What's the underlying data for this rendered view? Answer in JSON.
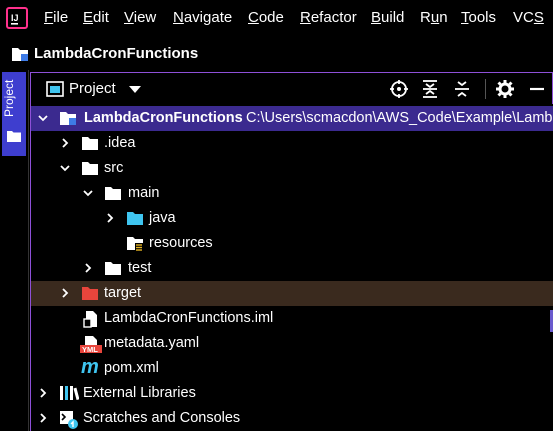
{
  "menu": {
    "items": [
      {
        "pre": "",
        "u": "F",
        "post": "ile"
      },
      {
        "pre": "",
        "u": "E",
        "post": "dit"
      },
      {
        "pre": "",
        "u": "V",
        "post": "iew"
      },
      {
        "pre": "",
        "u": "N",
        "post": "avigate"
      },
      {
        "pre": "",
        "u": "C",
        "post": "ode"
      },
      {
        "pre": "",
        "u": "R",
        "post": "efactor"
      },
      {
        "pre": "",
        "u": "B",
        "post": "uild"
      },
      {
        "pre": "R",
        "u": "u",
        "post": "n"
      },
      {
        "pre": "",
        "u": "T",
        "post": "ools"
      },
      {
        "pre": "VC",
        "u": "S",
        "post": ""
      }
    ]
  },
  "title": {
    "project": "LambdaCronFunctions"
  },
  "stripe": {
    "label": "Project"
  },
  "toolwindow": {
    "label": "Project"
  },
  "tree": {
    "root": {
      "name": "LambdaCronFunctions",
      "path": "C:\\Users\\scmacdon\\AWS_Code\\Example\\Lamb"
    },
    "idea": ".idea",
    "src": "src",
    "main": "main",
    "java": "java",
    "resources": "resources",
    "test": "test",
    "target": "target",
    "iml": "LambdaCronFunctions.iml",
    "yaml": "metadata.yaml",
    "pom": "pom.xml",
    "ext": "External Libraries",
    "scratches": "Scratches and Consoles"
  },
  "icons": {
    "yml_badge": "YML",
    "maven_glyph": "m"
  },
  "colors": {
    "accent": "#8e50d8",
    "selection": "#3b2a8f",
    "target_folder": "#e8453c",
    "java_folder": "#3fc5f0",
    "target_row": "#3a2a1e"
  }
}
